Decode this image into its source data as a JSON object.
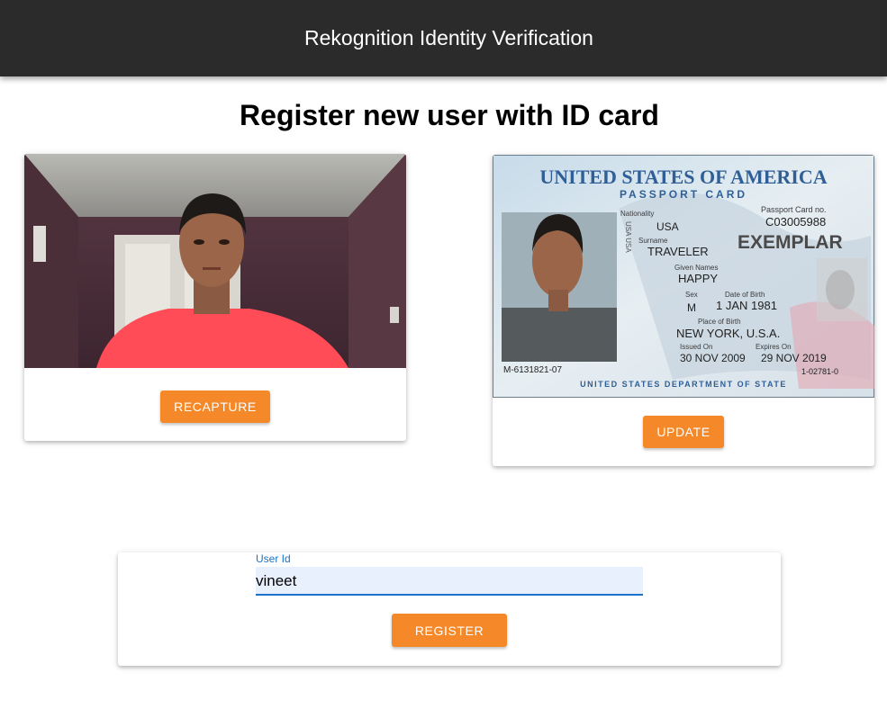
{
  "appbar": {
    "title": "Rekognition Identity Verification"
  },
  "page": {
    "title": "Register new user with ID card"
  },
  "selfie": {
    "button_label": "RECAPTURE"
  },
  "id_card": {
    "header": "UNITED STATES OF AMERICA",
    "subheader": "PASSPORT CARD",
    "nationality_label": "Nationality",
    "nationality": "USA",
    "surname_label": "Surname",
    "surname": "TRAVELER",
    "given_names_label": "Given Names",
    "given_names": "HAPPY",
    "sex_label": "Sex",
    "sex": "M",
    "dob_label": "Date of Birth",
    "dob": "1 JAN 1981",
    "pob_label": "Place of Birth",
    "pob": "NEW YORK, U.S.A.",
    "issued_label": "Issued On",
    "issued": "30 NOV 2009",
    "expires_label": "Expires On",
    "expires": "29 NOV 2019",
    "card_no_label": "Passport Card no.",
    "card_no": "C03005988",
    "exemplar": "EXEMPLAR",
    "left_code": "M-6131821-07",
    "right_code": "1-02781-0",
    "footer": "UNITED STATES DEPARTMENT OF STATE",
    "side_text": "USA USA",
    "button_label": "UPDATE"
  },
  "form": {
    "user_id_label": "User Id",
    "user_id_value": "vineet",
    "register_label": "REGISTER"
  },
  "colors": {
    "accent": "#f5892a",
    "appbar": "#2b2b2b",
    "field_focus": "#1a73c8"
  }
}
